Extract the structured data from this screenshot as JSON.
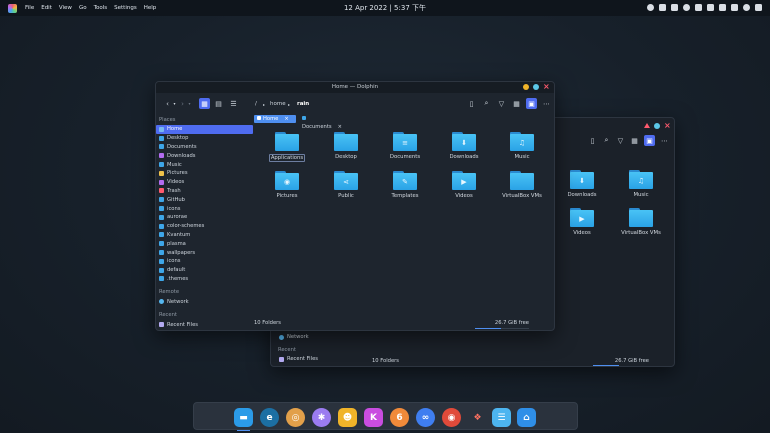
{
  "topbar": {
    "menus": [
      "File",
      "Edit",
      "View",
      "Go",
      "Tools",
      "Settings",
      "Help"
    ],
    "clock": "12 Apr 2022 | 5:37 下午"
  },
  "window": {
    "title": "Home — Dolphin",
    "breadcrumb": {
      "root": "/",
      "home": "home",
      "current": "rain"
    },
    "tabs": [
      {
        "label": "Home",
        "active": true
      },
      {
        "label": "Documents",
        "active": false
      }
    ],
    "sidebar": {
      "places_header": "Places",
      "places": [
        "Home",
        "Desktop",
        "Documents",
        "Downloads",
        "Music",
        "Pictures",
        "Videos",
        "Trash",
        "GitHub",
        "icons",
        "aurorae",
        "color-schemes",
        "Kvantum",
        "plasma",
        "wallpapers",
        "icons",
        "default",
        ".themes"
      ],
      "remote_header": "Remote",
      "remote": [
        "Network"
      ],
      "recent_header": "Recent",
      "recent": [
        "Recent Files"
      ]
    },
    "folders": [
      {
        "label": "Applications",
        "emblem": ""
      },
      {
        "label": "Desktop",
        "emblem": ""
      },
      {
        "label": "Documents",
        "emblem": "≡"
      },
      {
        "label": "Downloads",
        "emblem": "⬇"
      },
      {
        "label": "Music",
        "emblem": "♫"
      },
      {
        "label": "Pictures",
        "emblem": "◉"
      },
      {
        "label": "Public",
        "emblem": "⋖"
      },
      {
        "label": "Templates",
        "emblem": "✎"
      },
      {
        "label": "Videos",
        "emblem": "▶"
      },
      {
        "label": "VirtualBox VMs",
        "emblem": ""
      }
    ],
    "status": {
      "count": "10 Folders",
      "free": "26.7 GiB free",
      "usage_fraction": 0.48
    }
  },
  "bg_window": {
    "folders": [
      {
        "label": "Downloads",
        "emblem": "⬇"
      },
      {
        "label": "Music",
        "emblem": "♫"
      },
      {
        "label": "Videos",
        "emblem": "▶"
      },
      {
        "label": "VirtualBox VMs",
        "emblem": ""
      }
    ],
    "sidebar": {
      "network": "Network",
      "recent_header": "Recent",
      "recent": "Recent Files"
    },
    "status": {
      "count": "10 Folders",
      "free": "26.7 GiB free"
    }
  },
  "colors": {
    "accent": "#4f6cf0",
    "folder": "#3fb5f0",
    "close": "#ff5a6e"
  }
}
